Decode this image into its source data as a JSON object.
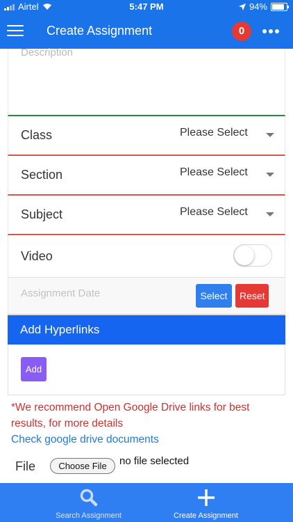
{
  "status_bar": {
    "carrier": "Airtel",
    "time": "5:47 PM",
    "battery": "94%",
    "battery_level": 0.94
  },
  "app_bar": {
    "title": "Create Assignment",
    "notification_count": "0"
  },
  "form": {
    "description_placeholder": "Description",
    "class": {
      "label": "Class",
      "value": "Please Select"
    },
    "section": {
      "label": "Section",
      "value": "Please Select"
    },
    "subject": {
      "label": "Subject",
      "value": "Please Select"
    },
    "video": {
      "label": "Video",
      "enabled": false
    },
    "assignment_date": {
      "placeholder": "Assignment Date",
      "select_label": "Select",
      "reset_label": "Reset"
    },
    "hyperlinks": {
      "title": "Add Hyperlinks",
      "add_label": "Add"
    },
    "note": {
      "warning": "*We recommend Open Google Drive links for best results, for more details",
      "link": "Check google drive documents"
    },
    "file": {
      "label": "File",
      "choose_label": "Choose File",
      "status": "no file selected"
    }
  },
  "tab_bar": {
    "search_label": "Search Assignment",
    "create_label": "Create Assignment"
  },
  "colors": {
    "primary": "#1a73e8",
    "danger": "#e53935",
    "accent": "#8a5cf6",
    "valid": "#1e8e3e",
    "invalid": "#d9534f"
  }
}
